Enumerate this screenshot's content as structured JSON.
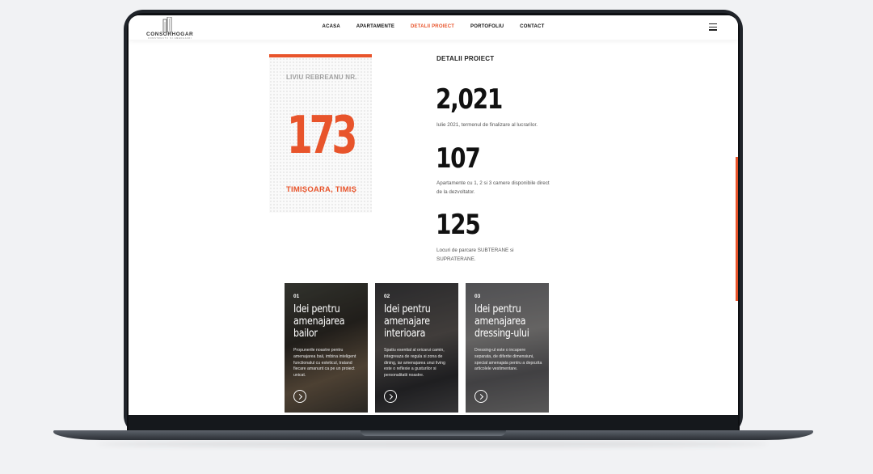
{
  "brand": {
    "name": "CONSORHOGAR",
    "tagline": "CONSTRUCTII SI AMENAJARI"
  },
  "nav": {
    "items": [
      {
        "label": "ACASA",
        "active": false
      },
      {
        "label": "APARTAMENTE",
        "active": false
      },
      {
        "label": "DETALII PROIECT",
        "active": true
      },
      {
        "label": "PORTOFOLIU",
        "active": false
      },
      {
        "label": "CONTACT",
        "active": false
      }
    ]
  },
  "address_card": {
    "street": "LIVIU REBREANU NR.",
    "number": "173",
    "city": "TIMIȘOARA, TIMIȘ"
  },
  "details": {
    "title": "DETALII PROIECT",
    "stats": [
      {
        "value": "2,021",
        "desc": "Iulie 2021, termenul de finalizare al lucrarilor."
      },
      {
        "value": "107",
        "desc": "Apartamente cu 1, 2 si 3 camere disponibile direct de la dezvoltator."
      },
      {
        "value": "125",
        "desc": "Locuri de parcare SUBTERANE si SUPRATERANE."
      }
    ]
  },
  "ideas": [
    {
      "num": "01",
      "title": "Idei pentru\namenajarea\nbailor",
      "text": "Propunerile noastre pentru amenajarea baii, imbina inteligent functionalul cu esteticul, tratand fiecare amanunt ca pe un proiect unicat."
    },
    {
      "num": "02",
      "title": "Idei pentru\namenajare\ninterioara",
      "text": "Spatiu esential al oricarui camin, integreaza de regula si zona de dining, iar amenajarea unui living este o reflexie a gusturilor si personalitatii noastre."
    },
    {
      "num": "03",
      "title": "Idei pentru\namenajarea\ndressing-ului",
      "text": "Dressing-ul este o incapere separata, de diferite dimensiuni, special amenajata pentru a depozita articolele vestimentare."
    }
  ],
  "colors": {
    "accent": "#e8542b",
    "dark": "#111111",
    "frame": "#20242a"
  }
}
